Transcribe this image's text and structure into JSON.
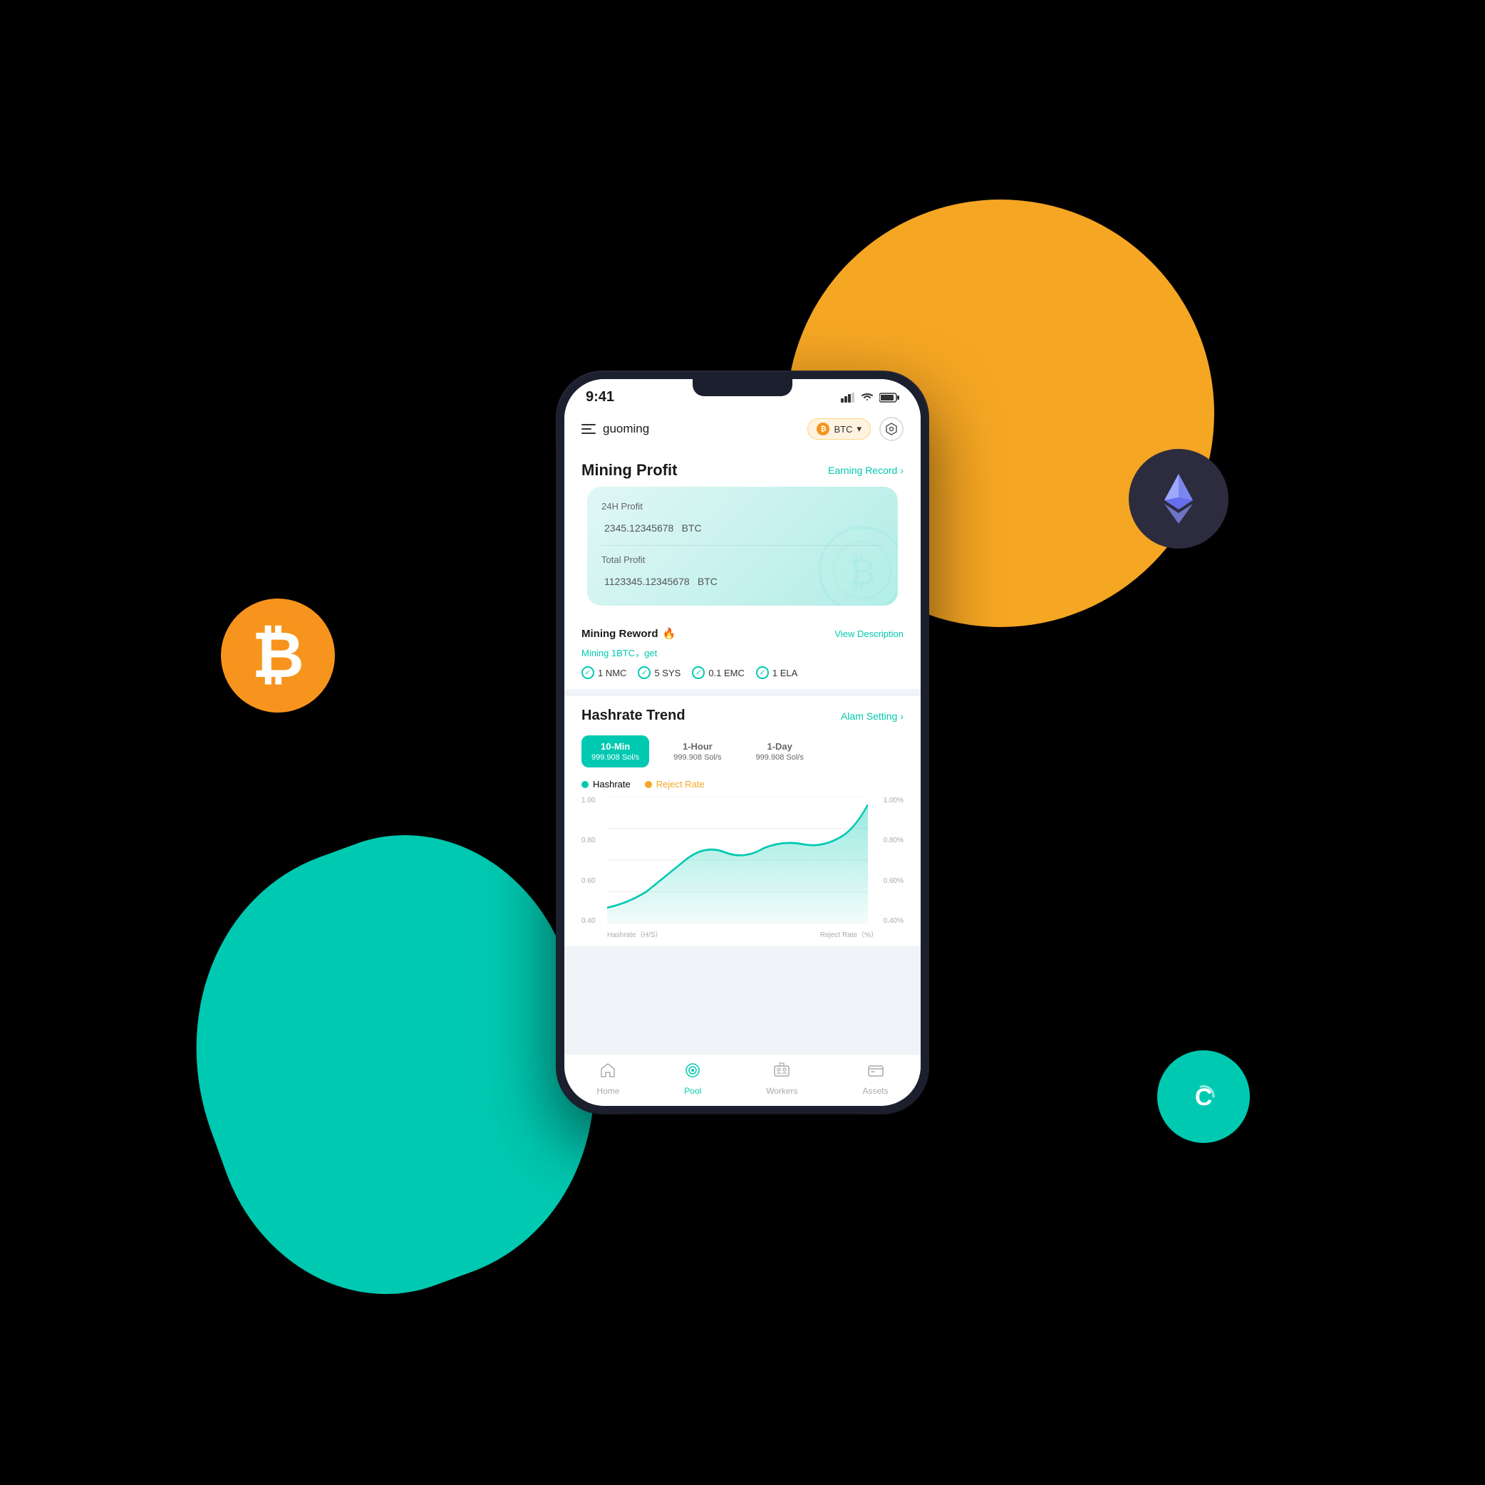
{
  "background": {
    "yellowCircle": true,
    "tealBlob": true
  },
  "phone": {
    "statusBar": {
      "time": "9:41",
      "batteryIcon": "🔋",
      "wifiIcon": "📶"
    },
    "header": {
      "username": "guoming",
      "currency": "BTC",
      "settingsIcon": "⬡"
    },
    "miningProfit": {
      "title": "Mining Profit",
      "earningRecord": "Earning Record",
      "earningRecordChevron": "›",
      "profit24h": {
        "label": "24H Profit",
        "amount": "2345.12345678",
        "currency": "BTC"
      },
      "totalProfit": {
        "label": "Total Profit",
        "amount": "1123345.12345678",
        "currency": "BTC"
      }
    },
    "miningReward": {
      "title": "Mining Reword",
      "fire": "🔥",
      "viewDescription": "View Description",
      "subtitle": "Mining 1BTC，get",
      "items": [
        {
          "label": "1 NMC"
        },
        {
          "label": "5 SYS"
        },
        {
          "label": "0.1 EMC"
        },
        {
          "label": "1 ELA"
        }
      ]
    },
    "hashrateTrend": {
      "title": "Hashrate Trend",
      "alamSetting": "Alam Setting",
      "alamSettingChevron": "›",
      "tabs": [
        {
          "label": "10-Min",
          "value": "999.908 Sol/s",
          "active": true
        },
        {
          "label": "1-Hour",
          "value": "999.908 Sol/s",
          "active": false
        },
        {
          "label": "1-Day",
          "value": "999.908 Sol/s",
          "active": false
        }
      ],
      "legend": [
        {
          "label": "Hashrate",
          "color": "#00C9B1"
        },
        {
          "label": "Reject Rate",
          "color": "#F5A623"
        }
      ],
      "chartYLeft": {
        "label": "Hashrate（H/S）",
        "values": [
          "1.00",
          "0.80",
          "0.60",
          "0.40"
        ]
      },
      "chartYRight": {
        "label": "Reject Rate（%）",
        "values": [
          "1.00%",
          "0.80%",
          "0.60%",
          "0.40%"
        ]
      }
    },
    "bottomNav": [
      {
        "label": "Home",
        "icon": "🏠",
        "active": false
      },
      {
        "label": "Pool",
        "icon": "🔄",
        "active": true
      },
      {
        "label": "Workers",
        "icon": "🎛",
        "active": false
      },
      {
        "label": "Assets",
        "icon": "💳",
        "active": false
      }
    ]
  },
  "btcIcon": "₿",
  "ethIconLabel": "ETH",
  "cIconLabel": "C"
}
